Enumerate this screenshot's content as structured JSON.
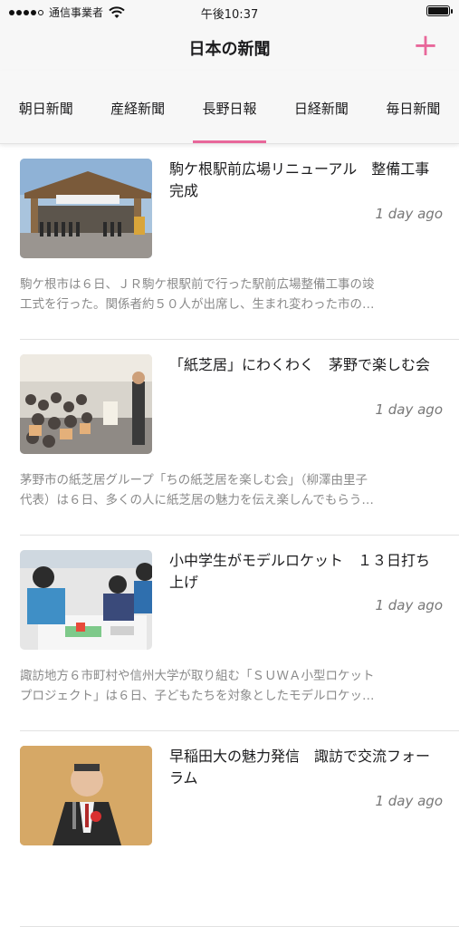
{
  "status_bar": {
    "carrier": "通信事業者",
    "time": "午後10:37"
  },
  "nav": {
    "title": "日本の新聞",
    "add_label": "+"
  },
  "tabs": [
    {
      "label": "朝日新聞",
      "active": false
    },
    {
      "label": "産経新聞",
      "active": false
    },
    {
      "label": "長野日報",
      "active": true
    },
    {
      "label": "日経新聞",
      "active": false
    },
    {
      "label": "毎日新聞",
      "active": false
    }
  ],
  "articles": [
    {
      "headline": "駒ケ根駅前広場リニューアル　整備工事完成",
      "time_ago": "1 day ago",
      "summary_line1": "駒ケ根市は６日、ＪＲ駒ケ根駅前で行った駅前広場整備工事の竣",
      "summary_line2": "工式を行った。関係者約５０人が出席し、生まれ変わった市の…"
    },
    {
      "headline": "「紙芝居」にわくわく　茅野で楽しむ会",
      "time_ago": "1 day ago",
      "summary_line1": "茅野市の紙芝居グループ「ちの紙芝居を楽しむ会」（柳澤由里子",
      "summary_line2": "代表）は６日、多くの人に紙芝居の魅力を伝え楽しんでもらう…"
    },
    {
      "headline": "小中学生がモデルロケット　１３日打ち上げ",
      "time_ago": "1 day ago",
      "summary_line1": "諏訪地方６市町村や信州大学が取り組む「ＳＵＷＡ小型ロケット",
      "summary_line2": "プロジェクト」は６日、子どもたちを対象としたモデルロケッ…"
    },
    {
      "headline": "早稲田大の魅力発信　諏訪で交流フォーラム",
      "time_ago": "1 day ago",
      "summary_line1": "",
      "summary_line2": ""
    }
  ],
  "colors": {
    "accent": "#e8679a",
    "bar_background": "#f7f7f7",
    "muted_text": "#8a8a8a"
  }
}
